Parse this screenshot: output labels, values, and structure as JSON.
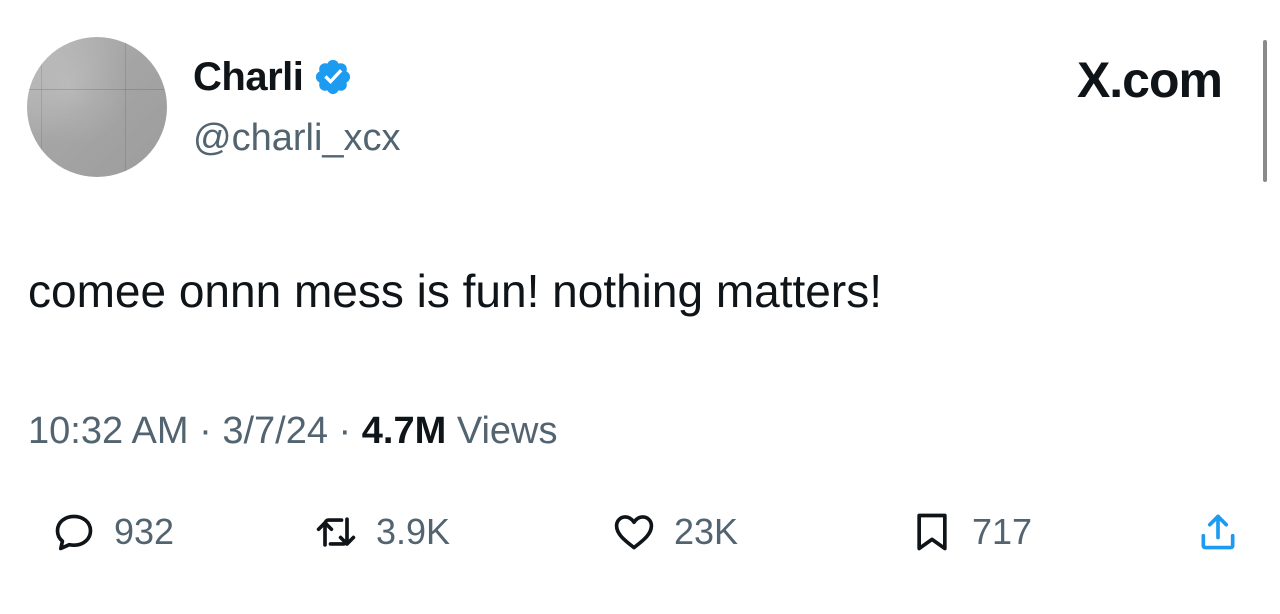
{
  "tweet": {
    "author": {
      "display_name": "Charli",
      "handle": "@charli_xcx",
      "verified": true,
      "avatar_icon": "profile-avatar"
    },
    "brand": "X.com",
    "text": "comee onnn mess is fun! nothing matters!",
    "meta": {
      "time": "10:32 AM",
      "separator": " · ",
      "date": "3/7/24",
      "views_count": "4.7M",
      "views_label": " Views"
    },
    "actions": {
      "replies": "932",
      "reposts": "3.9K",
      "likes": "23K",
      "bookmarks": "717"
    }
  },
  "colors": {
    "text_primary": "#0f1419",
    "text_secondary": "#536471",
    "verified_blue": "#1d9bf0",
    "background": "#ffffff"
  },
  "icons": {
    "reply": "speech-bubble-icon",
    "repost": "repost-arrows-icon",
    "like": "heart-icon",
    "bookmark": "bookmark-icon",
    "share": "share-upload-icon",
    "verified": "verified-badge-icon"
  }
}
